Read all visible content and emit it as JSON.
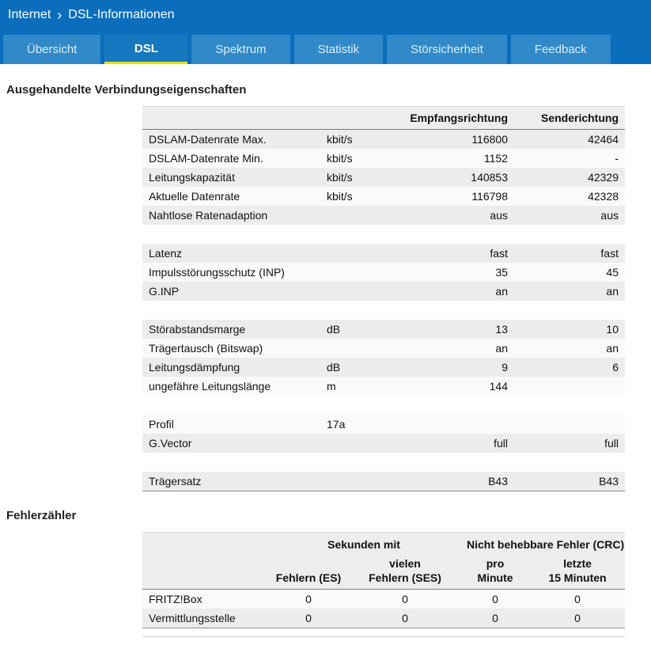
{
  "breadcrumb": {
    "section": "Internet",
    "separator": "›",
    "page": "DSL-Informationen"
  },
  "tabs": [
    {
      "label": "Übersicht",
      "active": false
    },
    {
      "label": "DSL",
      "active": true
    },
    {
      "label": "Spektrum",
      "active": false
    },
    {
      "label": "Statistik",
      "active": false
    },
    {
      "label": "Störsicherheit",
      "active": false
    },
    {
      "label": "Feedback",
      "active": false
    }
  ],
  "colors": {
    "header_blue": "#0a6ebd",
    "tab_blue": "#3089c8",
    "active_tab_blue": "#1678bf",
    "active_underline": "#e8e200"
  },
  "connection_section": {
    "title": "Ausgehandelte Verbindungseigenschaften",
    "table": {
      "col_rx": "Empfangsrichtung",
      "col_tx": "Senderichtung",
      "rows": [
        {
          "name": "DSLAM-Datenrate Max.",
          "unit": "kbit/s",
          "rx": "116800",
          "tx": "42464"
        },
        {
          "name": "DSLAM-Datenrate Min.",
          "unit": "kbit/s",
          "rx": "1152",
          "tx": "-"
        },
        {
          "name": "Leitungskapazität",
          "unit": "kbit/s",
          "rx": "140853",
          "tx": "42329"
        },
        {
          "name": "Aktuelle Datenrate",
          "unit": "kbit/s",
          "rx": "116798",
          "tx": "42328"
        },
        {
          "name": "Nahtlose Ratenadaption",
          "unit": "",
          "rx": "aus",
          "tx": "aus"
        },
        {
          "spacer": true
        },
        {
          "name": "Latenz",
          "unit": "",
          "rx": "fast",
          "tx": "fast"
        },
        {
          "name": "Impulsstörungsschutz (INP)",
          "unit": "",
          "rx": "35",
          "tx": "45"
        },
        {
          "name": "G.INP",
          "unit": "",
          "rx": "an",
          "tx": "an"
        },
        {
          "spacer": true
        },
        {
          "name": "Störabstandsmarge",
          "unit": "dB",
          "rx": "13",
          "tx": "10"
        },
        {
          "name": "Trägertausch (Bitswap)",
          "unit": "",
          "rx": "an",
          "tx": "an"
        },
        {
          "name": "Leitungsdämpfung",
          "unit": "dB",
          "rx": "9",
          "tx": "6"
        },
        {
          "name": "ungefähre Leitungslänge",
          "unit": "m",
          "rx": "144",
          "tx": ""
        },
        {
          "spacer": true
        },
        {
          "name": "Profil",
          "unit": "17a",
          "rx": "",
          "tx": ""
        },
        {
          "name": "G.Vector",
          "unit": "",
          "rx": "full",
          "tx": "full"
        },
        {
          "spacer": true
        },
        {
          "name": "Trägersatz",
          "unit": "",
          "rx": "B43",
          "tx": "B43"
        }
      ]
    }
  },
  "error_section": {
    "title": "Fehlerzähler",
    "table": {
      "group_seconds": "Sekunden mit",
      "group_crc": "Nicht behebbare Fehler (CRC)",
      "col_es": "Fehlern (ES)",
      "col_ses": "vielen\nFehlern (SES)",
      "col_pro": "pro\nMinute",
      "col_last": "letzte\n15 Minuten",
      "rows": [
        {
          "name": "FRITZ!Box",
          "es": "0",
          "ses": "0",
          "pro": "0",
          "last": "0"
        },
        {
          "name": "Vermittlungsstelle",
          "es": "0",
          "ses": "0",
          "pro": "0",
          "last": "0"
        }
      ]
    }
  }
}
